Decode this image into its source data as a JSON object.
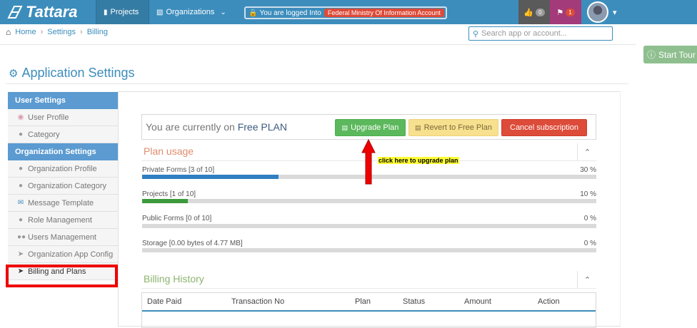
{
  "navbar": {
    "brand": "Tattara",
    "projects": "Projects",
    "organizations": "Organizations",
    "logged_in_text": "You are logged Into",
    "account_name": "Federal Ministry Of Information Account",
    "likes_count": "0",
    "flags_count": "1"
  },
  "breadcrumb": [
    "Home",
    "Settings",
    "Billing"
  ],
  "search": {
    "placeholder": "Search app or account..."
  },
  "start_tour": "Start Tour",
  "page_title": "Application Settings",
  "sidebar": {
    "user_settings_title": "User Settings",
    "user_items": [
      {
        "label": "User Profile",
        "icon": "palette-icon"
      },
      {
        "label": "Category",
        "icon": "user-icon"
      }
    ],
    "org_settings_title": "Organization Settings",
    "org_items": [
      {
        "label": "Organization Profile",
        "icon": "user-icon"
      },
      {
        "label": "Organization Category",
        "icon": "user-icon"
      },
      {
        "label": "Message Template",
        "icon": "envelope-icon"
      },
      {
        "label": "Role Management",
        "icon": "user-icon"
      },
      {
        "label": "Users Management",
        "icon": "users-icon"
      },
      {
        "label": "Organization App Config",
        "icon": "send-icon"
      },
      {
        "label": "Billing and Plans",
        "icon": "rocket-icon"
      }
    ]
  },
  "plan": {
    "current_prefix": "You are currently on",
    "current_plan": "Free PLAN",
    "upgrade_label": "Upgrade Plan",
    "revert_label": "Revert to Free Plan",
    "cancel_label": "Cancel subscription"
  },
  "annotation": "click here to upgrade plan",
  "usage": {
    "title": "Plan usage",
    "items": [
      {
        "label": "Private Forms [3 of 10]",
        "percent_text": "30 %",
        "fraction": 0.3,
        "color": "#2f7fc1"
      },
      {
        "label": "Projects [1 of 10]",
        "percent_text": "10 %",
        "fraction": 0.1,
        "color": "#3c9a3c"
      },
      {
        "label": "Public Forms [0 of 10]",
        "percent_text": "0 %",
        "fraction": 0,
        "color": "#2f7fc1"
      },
      {
        "label": "Storage [0.00 bytes of 4.77 MB]",
        "percent_text": "0 %",
        "fraction": 0,
        "color": "#2f7fc1"
      }
    ]
  },
  "billing": {
    "title": "Billing History",
    "columns": [
      "Date Paid",
      "Transaction No",
      "Plan",
      "Status",
      "Amount",
      "Action"
    ]
  }
}
